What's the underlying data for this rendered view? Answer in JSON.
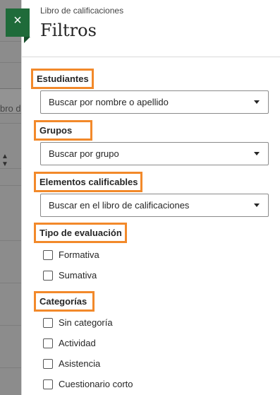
{
  "background": {
    "partial_text": "bro de"
  },
  "close_button": {
    "label": "×"
  },
  "panel": {
    "subtitle": "Libro de calificaciones",
    "title": "Filtros"
  },
  "sections": {
    "students": {
      "label": "Estudiantes",
      "select_value": "Buscar por nombre o apellido"
    },
    "groups": {
      "label": "Grupos",
      "select_value": "Buscar por grupo"
    },
    "gradable_items": {
      "label": "Elementos calificables",
      "select_value": "Buscar en el libro de calificaciones"
    },
    "assessment_type": {
      "label": "Tipo de evaluación",
      "options": [
        "Formativa",
        "Sumativa"
      ]
    },
    "categories": {
      "label": "Categorías",
      "options": [
        "Sin categoría",
        "Actividad",
        "Asistencia",
        "Cuestionario corto"
      ]
    }
  },
  "colors": {
    "accent_green": "#1f6b3a",
    "highlight_orange": "#f2892a"
  }
}
